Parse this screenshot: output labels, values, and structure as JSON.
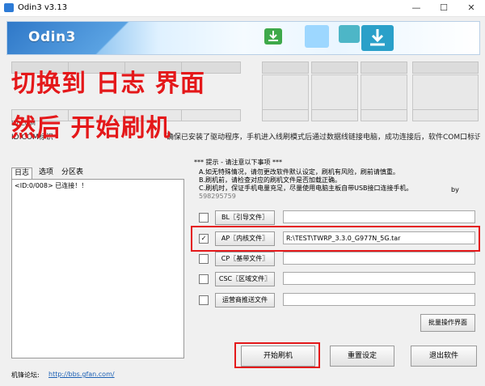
{
  "window": {
    "title": "Odin3 v3.13",
    "min": "—",
    "max": "☐",
    "close": "✕"
  },
  "banner": {
    "logo": "Odin3"
  },
  "overlay": {
    "line1": "切换到 日志 界面",
    "line2": "然后 开始刷机"
  },
  "id_com": {
    "label_id": "ID:COM",
    "label_com": "ID:COM标识"
  },
  "notice_text": "确保已安装了驱动程序，手机进入线刷模式后通过数据线链接电脑，成功连接后，软件COM口标识会变成",
  "tabs": [
    {
      "label": "日志"
    },
    {
      "label": "选项"
    },
    {
      "label": "分区表"
    }
  ],
  "log": {
    "line1": "<ID:0/008> 已连接！！"
  },
  "tips": {
    "heading": "*** 提示 - 请注意以下事项 ***",
    "a": "A.如无特殊情况，请勿更改软件默认设定，刷机有风险，刷前请慎重。",
    "b": "B.刷机前，请检查对应的刷机文件是否加载正确。",
    "c": "C.刷机时，保证手机电量充足，尽量使用电脑主板自带USB接口连接手机。",
    "by": "by",
    "code": "598295759"
  },
  "files": [
    {
      "btn": "BL〖引导文件〗",
      "checked": "",
      "path": ""
    },
    {
      "btn": "AP〖内核文件〗",
      "checked": "✓",
      "path": "R:\\TEST\\TWRP_3.3.0_G977N_5G.tar"
    },
    {
      "btn": "CP〖基带文件〗",
      "checked": "",
      "path": ""
    },
    {
      "btn": "CSC〖区域文件〗",
      "checked": "",
      "path": ""
    },
    {
      "btn": "运营商推送文件",
      "checked": "",
      "path": ""
    }
  ],
  "batch_btn": "批量操作界面",
  "actions": {
    "start": "开始刷机",
    "reset": "重置设定",
    "exit": "退出软件"
  },
  "footer": {
    "label": "机锋论坛:",
    "link": "http://bbs.gfan.com/"
  },
  "colors": {
    "highlight": "#e4181a",
    "link": "#1a5fb4"
  }
}
